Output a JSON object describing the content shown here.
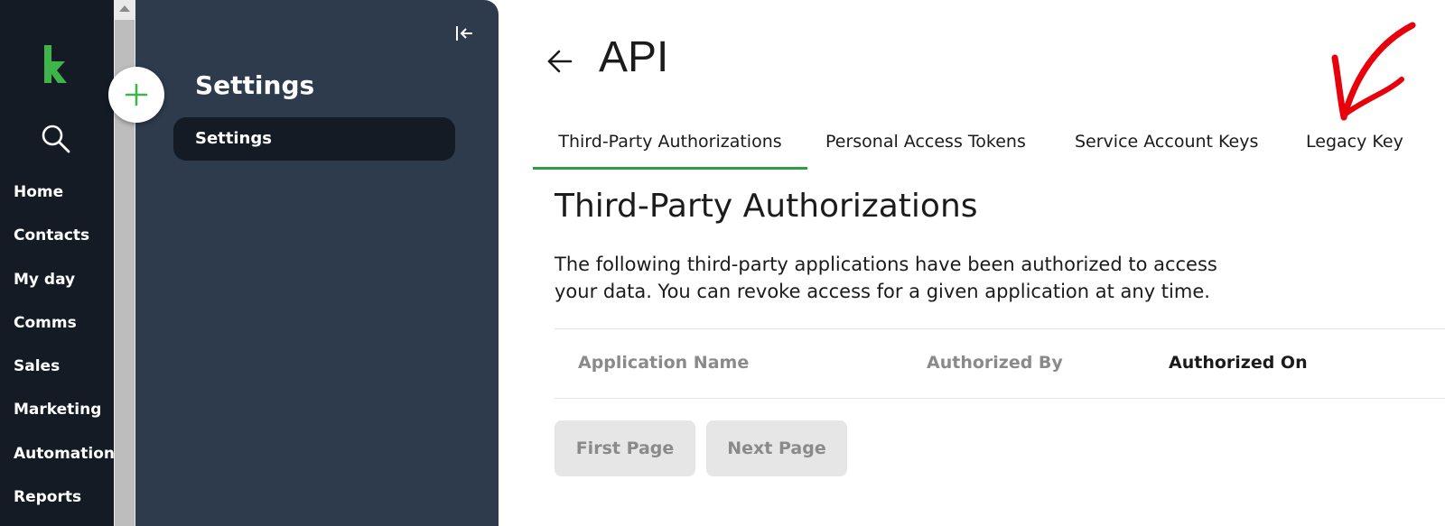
{
  "nav": {
    "items": [
      {
        "label": "Home"
      },
      {
        "label": "Contacts"
      },
      {
        "label": "My day"
      },
      {
        "label": "Comms"
      },
      {
        "label": "Sales"
      },
      {
        "label": "Marketing"
      },
      {
        "label": "Automation"
      },
      {
        "label": "Reports"
      }
    ],
    "brand_color": "#3eb549"
  },
  "settings_panel": {
    "title": "Settings",
    "items": [
      {
        "label": "Settings"
      }
    ]
  },
  "header": {
    "title": "API"
  },
  "tabs": [
    {
      "label": "Third-Party Authorizations",
      "active": true
    },
    {
      "label": "Personal Access Tokens",
      "active": false
    },
    {
      "label": "Service Account Keys",
      "active": false
    },
    {
      "label": "Legacy Key",
      "active": false
    }
  ],
  "section": {
    "title": "Third-Party Authorizations",
    "description_line1": "The following third-party applications have been authorized to access",
    "description_line2": "your data. You can revoke access for a given application at any time."
  },
  "table": {
    "columns": [
      "Application Name",
      "Authorized By",
      "Authorized On"
    ]
  },
  "pagination": {
    "first_label": "First Page",
    "next_label": "Next Page"
  },
  "colors": {
    "accent": "#2e9e3f",
    "annotation": "#e8000b"
  }
}
